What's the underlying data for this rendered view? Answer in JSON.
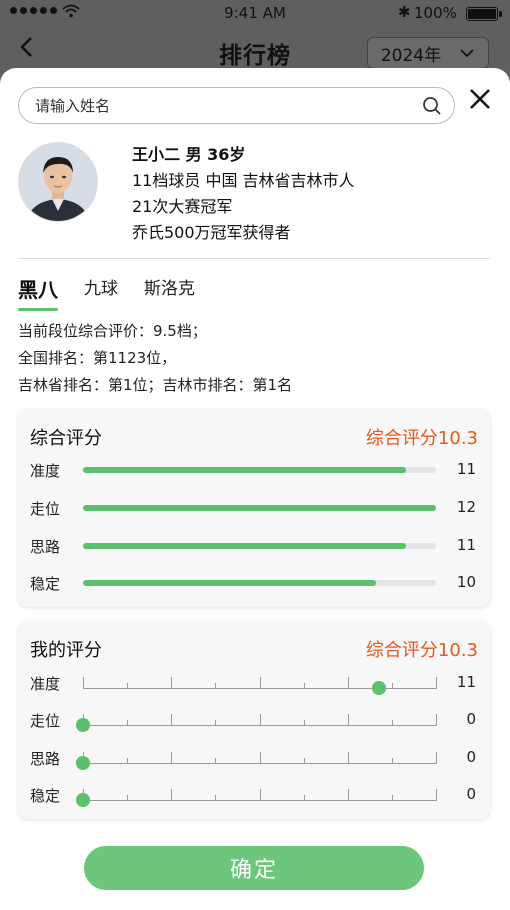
{
  "status_bar": {
    "time": "9:41 AM",
    "battery": "100%"
  },
  "nav": {
    "title": "排行榜",
    "year": "2024年"
  },
  "search": {
    "placeholder": "请输入姓名"
  },
  "profile": {
    "name_line": "王小二 男 36岁",
    "line2": "11档球员  中国 吉林省吉林市人",
    "line3": "21次大赛冠军",
    "line4": "乔氏500万冠军获得者"
  },
  "tabs": [
    {
      "label": "黑八",
      "active": true
    },
    {
      "label": "九球",
      "active": false
    },
    {
      "label": "斯洛克",
      "active": false
    }
  ],
  "stats": {
    "line1": "当前段位综合评价：9.5档；",
    "line2": "全国排名：第1123位，",
    "line3": "吉林省排名：第1位；吉林市排名：第1名"
  },
  "overall_card": {
    "title": "综合评分",
    "score": "综合评分10.3",
    "rows": [
      {
        "label": "准度",
        "value": "11",
        "fill": 0.915
      },
      {
        "label": "走位",
        "value": "12",
        "fill": 1.0
      },
      {
        "label": "思路",
        "value": "11",
        "fill": 0.915
      },
      {
        "label": "稳定",
        "value": "10",
        "fill": 0.83
      }
    ]
  },
  "my_card": {
    "title": "我的评分",
    "score": "综合评分10.3",
    "slider_max": 12,
    "rows": [
      {
        "label": "准度",
        "value": "11",
        "level": 11
      },
      {
        "label": "走位",
        "value": "0",
        "level": 0
      },
      {
        "label": "思路",
        "value": "0",
        "level": 0
      },
      {
        "label": "稳定",
        "value": "0",
        "level": 0
      }
    ]
  },
  "confirm_label": "确定",
  "colors": {
    "accent": "#5cbf6c",
    "score": "#e8571d"
  }
}
